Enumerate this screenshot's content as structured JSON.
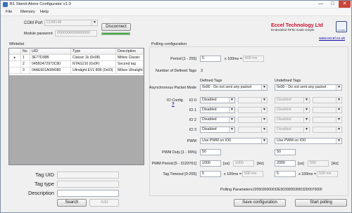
{
  "window": {
    "title": "B1 Stand-Alone Configurator v1.0",
    "minimize_icon": "—",
    "maximize_icon": "□",
    "close_icon": "✕"
  },
  "menu": [
    "File",
    "Memory",
    "Help"
  ],
  "connection": {
    "com_port_label": "COM Port",
    "com_port_value": "COM148",
    "disconnect_label": "Disconnect",
    "module_password_label": "Module password",
    "module_password_value": "0000000000000000",
    "progress": 1.0,
    "progress_color": "#3bb53b"
  },
  "logo": {
    "company": "Eccel Technology Ltd",
    "tagline": "Embedded RFID made simple",
    "iso_text": "ISO 9001",
    "url": "www.eccel.co.uk",
    "brand_color": "#c8102e"
  },
  "whitelist": {
    "label": "Whitelist",
    "columns": [
      "No",
      "UID",
      "Type",
      "Description"
    ],
    "rows": [
      {
        "marker": "▸",
        "no": "1",
        "uid": "3E77D38B",
        "type": "Classic 1k (0x08)",
        "desc": "Mifare Classic"
      },
      {
        "marker": "",
        "no": "2",
        "uid": "045B3472973C80",
        "type": "NTAG216 (0x0F)",
        "desc": "Second tag"
      },
      {
        "marker": "",
        "no": "3",
        "uid": "04AE601A084080",
        "type": "Ultralight EV1 80B (0x03)",
        "desc": "Mifare Ultralight"
      }
    ]
  },
  "tag_form": {
    "uid_label": "Tag UID",
    "uid_value": "",
    "type_label": "Tag type",
    "type_value": "",
    "desc_label": "Description",
    "desc_value": "",
    "search_label": "Search",
    "add_label": "Add"
  },
  "polling": {
    "group_label": "Polling configuration",
    "period_label": "Period [1 - 255]",
    "period_value": "5",
    "period_unit": "x 100ms =",
    "period_result": "500 ms",
    "defined_tags_label": "Number of Defined Tags",
    "defined_tags_value": "3",
    "defined_header": "Defined Tags",
    "undefined_header": "Undefined Tags",
    "async_label": "Asynchronous Packet Mode",
    "async_defined": "0x00 - Do not sent any packet",
    "async_undefined": "0x00 - Do not sent any packet",
    "io_config_label": "IO Config",
    "io_help": "?",
    "io_rows": [
      {
        "label": "IO 0",
        "defined": "Disabled",
        "undefined": "Disabled"
      },
      {
        "label": "IO 1",
        "defined": "Disabled",
        "undefined": "Disabled"
      },
      {
        "label": "IO 2",
        "defined": "Disabled",
        "undefined": "Disabled"
      },
      {
        "label": "IO 3",
        "defined": "Disabled",
        "undefined": "Disabled"
      }
    ],
    "pwm_label": "PWM",
    "pwm_defined": "Use PWM on IO0",
    "pwm_undefined": "Use PWM on IO0",
    "pwm_duty_label": "PWM Duty [1 - 99%]",
    "pwm_duty_defined": "50",
    "pwm_duty_undefined": "50",
    "pwm_period_label": "PWM Period [5 - 3120761]",
    "pwm_period_defined": "1000",
    "pwm_period_defined_unit": "[us]",
    "pwm_period_defined_hz": "1000",
    "pwm_period_defined_hz_unit": "[Hz]",
    "pwm_period_undefined": "2000",
    "pwm_period_undefined_unit": "[us]",
    "pwm_period_undefined_hz": "500",
    "pwm_period_undefined_hz_unit": "[Hz]",
    "tag_timeout_label": "Tag Timeout [0-255]",
    "tag_timeout_defined": "5",
    "tag_timeout_defined_unit": "x 100ms =",
    "tag_timeout_defined_result": "500 ms",
    "tag_timeout_undefined": "5",
    "tag_timeout_undefined_unit": "x 100ms =",
    "tag_timeout_undefined_result": "500 ms",
    "params_label": "Polling Parameters",
    "params_value": "2205030000032E0030005000032D0070005"
  },
  "footer": {
    "save_label": "Save configuration",
    "start_label": "Start polling"
  }
}
